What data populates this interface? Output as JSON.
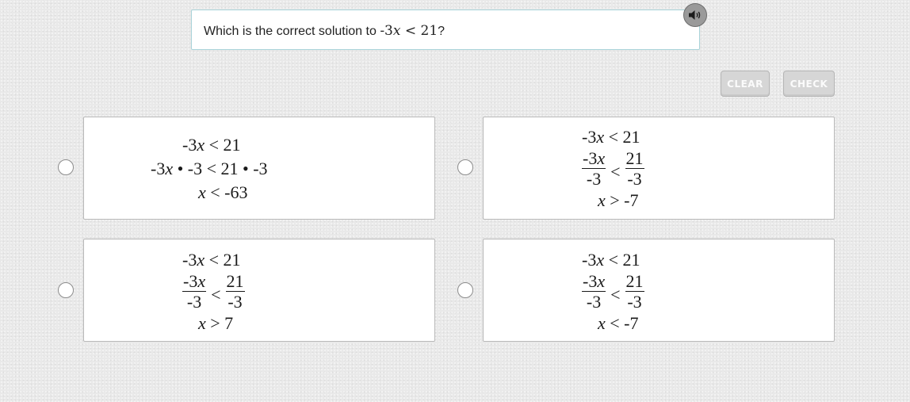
{
  "question": {
    "prefix": "Which is the correct solution to ",
    "expr_coef": "-3",
    "expr_var": "x",
    "expr_rel": " < 21",
    "suffix": "?"
  },
  "audio_icon": "speaker-icon",
  "buttons": {
    "clear": "CLEAR",
    "check": "CHECK"
  },
  "options": [
    {
      "line1": {
        "left": "-3",
        "var": "x",
        "right": " < 21"
      },
      "line2": {
        "left": "-3",
        "var": "x",
        "right": " • -3 < 21 • -3"
      },
      "line3": {
        "var": "x",
        "right": " < -63"
      }
    },
    {
      "line1": {
        "left": "-3",
        "var": "x",
        "right": " < 21"
      },
      "frac": {
        "num_left": "-3",
        "num_var": "x",
        "den_left": "-3",
        "rel": "<",
        "num_right": "21",
        "den_right": "-3"
      },
      "line3": {
        "var": "x",
        "right": " > -7"
      }
    },
    {
      "line1": {
        "left": "-3",
        "var": "x",
        "right": " < 21"
      },
      "frac": {
        "num_left": "-3",
        "num_var": "x",
        "den_left": "-3",
        "rel": "<",
        "num_right": "21",
        "den_right": "-3"
      },
      "line3": {
        "var": "x",
        "right": " > 7"
      }
    },
    {
      "line1": {
        "left": "-3",
        "var": "x",
        "right": " < 21"
      },
      "frac": {
        "num_left": "-3",
        "num_var": "x",
        "den_left": "-3",
        "rel": "<",
        "num_right": "21",
        "den_right": "-3"
      },
      "line3": {
        "var": "x",
        "right": " < -7"
      }
    }
  ]
}
